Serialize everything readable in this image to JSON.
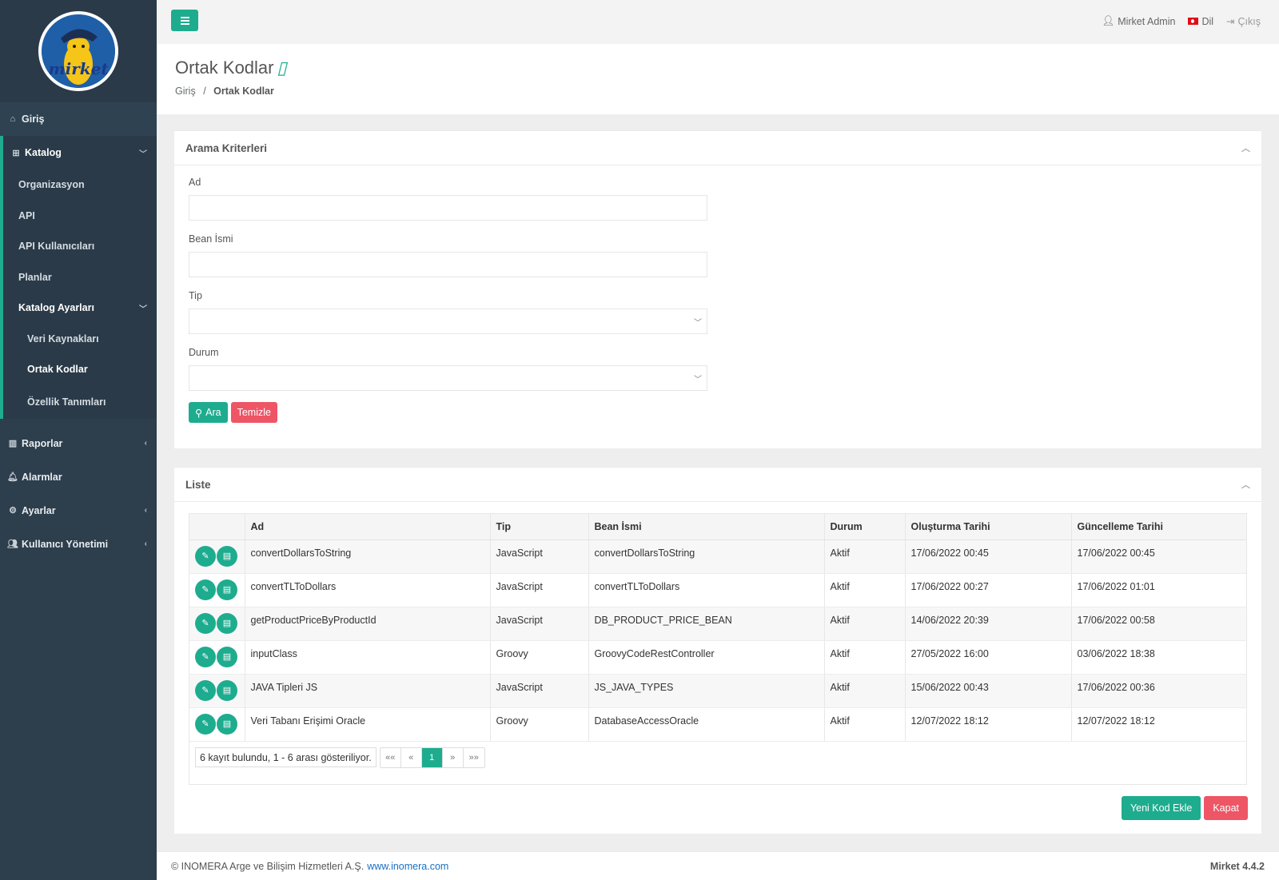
{
  "sidebar": {
    "logo_text": "mirket",
    "items": [
      {
        "label": "Giriş",
        "icon": "home-icon"
      },
      {
        "label": "Katalog",
        "icon": "sitemap-icon"
      },
      {
        "label": "Raporlar",
        "icon": "chart-icon"
      },
      {
        "label": "Alarmlar",
        "icon": "bell-icon"
      },
      {
        "label": "Ayarlar",
        "icon": "cogs-icon"
      },
      {
        "label": "Kullanıcı Yönetimi",
        "icon": "users-icon"
      }
    ],
    "catalog_sub": [
      "Organizasyon",
      "API",
      "API Kullanıcıları",
      "Planlar",
      "Katalog Ayarları"
    ],
    "catalog_settings_sub": [
      "Veri Kaynakları",
      "Ortak Kodlar",
      "Özellik Tanımları"
    ]
  },
  "topbar": {
    "user": "Mirket Admin",
    "language": "Dil",
    "logout": "Çıkış"
  },
  "header": {
    "title": "Ortak Kodlar",
    "breadcrumb_home": "Giriş",
    "breadcrumb_sep": "/",
    "breadcrumb_current": "Ortak Kodlar"
  },
  "search": {
    "title": "Arama Kriterleri",
    "fields": {
      "name": "Ad",
      "bean": "Bean İsmi",
      "type": "Tip",
      "status": "Durum"
    },
    "search_button": "Ara",
    "clear_button": "Temizle"
  },
  "list": {
    "title": "Liste",
    "columns": [
      "Ad",
      "Tip",
      "Bean İsmi",
      "Durum",
      "Oluşturma Tarihi",
      "Güncelleme Tarihi"
    ],
    "rows": [
      [
        "convertDollarsToString",
        "JavaScript",
        "convertDollarsToString",
        "Aktif",
        "17/06/2022 00:45",
        "17/06/2022 00:45"
      ],
      [
        "convertTLToDollars",
        "JavaScript",
        "convertTLToDollars",
        "Aktif",
        "17/06/2022 00:27",
        "17/06/2022 01:01"
      ],
      [
        "getProductPriceByProductId",
        "JavaScript",
        "DB_PRODUCT_PRICE_BEAN",
        "Aktif",
        "14/06/2022 20:39",
        "17/06/2022 00:58"
      ],
      [
        "inputClass",
        "Groovy",
        "GroovyCodeRestController",
        "Aktif",
        "27/05/2022 16:00",
        "03/06/2022 18:38"
      ],
      [
        "JAVA Tipleri JS",
        "JavaScript",
        "JS_JAVA_TYPES",
        "Aktif",
        "15/06/2022 00:43",
        "17/06/2022 00:36"
      ],
      [
        "Veri Tabanı Erişimi Oracle",
        "Groovy",
        "DatabaseAccessOracle",
        "Aktif",
        "12/07/2022 18:12",
        "12/07/2022 18:12"
      ]
    ],
    "pager_info": "6 kayıt bulundu, 1 - 6 arası gösteriliyor.",
    "pager": {
      "first": "««",
      "prev": "«",
      "page": "1",
      "next": "»",
      "last": "»»"
    },
    "add_button": "Yeni Kod Ekle",
    "close_button": "Kapat"
  },
  "footer": {
    "copyright": "© INOMERA Arge ve Bilişim Hizmetleri A.Ş.",
    "link": "www.inomera.com",
    "version": "Mirket 4.4.2"
  },
  "colors": {
    "accent": "#1eac8e",
    "danger": "#ee5565",
    "sidebar": "#2d3e4d"
  }
}
